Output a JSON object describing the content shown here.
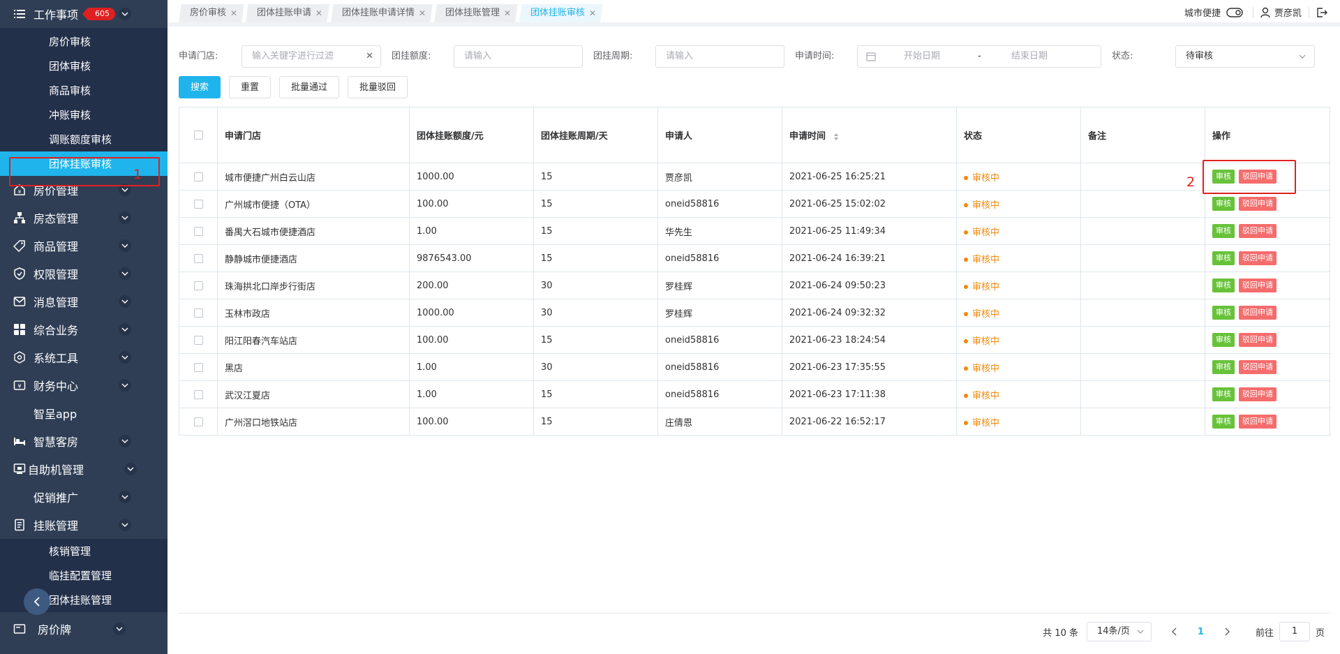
{
  "sidebar": {
    "top_item": {
      "label": "工作事项",
      "badge": "605",
      "icon": "list-icon"
    },
    "top_subitems": [
      "房价审核",
      "团体审核",
      "商品审核",
      "冲账审核",
      "调账额度审核",
      "团体挂账审核"
    ],
    "menu": [
      {
        "label": "房价管理",
        "icon": "home-price-icon"
      },
      {
        "label": "房态管理",
        "icon": "org-chart-icon"
      },
      {
        "label": "商品管理",
        "icon": "tag-icon"
      },
      {
        "label": "权限管理",
        "icon": "shield-icon"
      },
      {
        "label": "消息管理",
        "icon": "message-icon"
      },
      {
        "label": "综合业务",
        "icon": "grid-icon"
      },
      {
        "label": "系统工具",
        "icon": "hexagon-icon"
      },
      {
        "label": "财务中心",
        "icon": "finance-icon"
      },
      {
        "label": "智呈app",
        "icon": ""
      },
      {
        "label": "智慧客房",
        "icon": "bed-icon"
      },
      {
        "label": "自助机管理",
        "icon": "kiosk-icon"
      },
      {
        "label": "促销推广",
        "icon": ""
      },
      {
        "label": "挂账管理",
        "icon": "ledger-icon"
      }
    ],
    "bottom_subitems": [
      "核销管理",
      "临挂配置管理",
      "团体挂账管理"
    ],
    "last_item": {
      "label": "房价牌",
      "icon": "price-board-icon"
    }
  },
  "tabs": [
    {
      "label": "房价审核",
      "active": false
    },
    {
      "label": "团体挂账申请",
      "active": false
    },
    {
      "label": "团体挂账申请详情",
      "active": false
    },
    {
      "label": "团体挂账管理",
      "active": false
    },
    {
      "label": "团体挂账审核",
      "active": true
    }
  ],
  "topbar": {
    "hotel": "城市便捷",
    "user": "贾彦凯"
  },
  "filters": {
    "store_label": "申请门店:",
    "store_placeholder": "输入关键字进行过滤",
    "amount_label": "团挂额度:",
    "amount_placeholder": "请输入",
    "period_label": "团挂周期:",
    "period_placeholder": "请输入",
    "time_label": "申请时间:",
    "start_placeholder": "开始日期",
    "date_sep": "-",
    "end_placeholder": "结束日期",
    "status_label": "状态:",
    "status_value": "待审核"
  },
  "buttons": {
    "search": "搜索",
    "reset": "重置",
    "batch_pass": "批量通过",
    "batch_reject": "批量驳回"
  },
  "table": {
    "headers": [
      "申请门店",
      "团体挂账额度/元",
      "团体挂账周期/天",
      "申请人",
      "申请时间",
      "状态",
      "备注",
      "操作"
    ],
    "rows": [
      {
        "store": "城市便捷广州白云山店",
        "amount": "1000.00",
        "period": "15",
        "applicant": "贾彦凯",
        "time": "2021-06-25 16:25:21",
        "status": "审核中",
        "note": ""
      },
      {
        "store": "广州城市便捷（OTA）",
        "amount": "100.00",
        "period": "15",
        "applicant": "oneid58816",
        "time": "2021-06-25 15:02:02",
        "status": "审核中",
        "note": ""
      },
      {
        "store": "番禺大石城市便捷酒店",
        "amount": "1.00",
        "period": "15",
        "applicant": "华先生",
        "time": "2021-06-25 11:49:34",
        "status": "审核中",
        "note": ""
      },
      {
        "store": "静静城市便捷酒店",
        "amount": "9876543.00",
        "period": "15",
        "applicant": "oneid58816",
        "time": "2021-06-24 16:39:21",
        "status": "审核中",
        "note": ""
      },
      {
        "store": "珠海拱北口岸步行街店",
        "amount": "200.00",
        "period": "30",
        "applicant": "罗桂辉",
        "time": "2021-06-24 09:50:23",
        "status": "审核中",
        "note": ""
      },
      {
        "store": "玉林市政店",
        "amount": "1000.00",
        "period": "30",
        "applicant": "罗桂辉",
        "time": "2021-06-24 09:32:32",
        "status": "审核中",
        "note": ""
      },
      {
        "store": "阳江阳春汽车站店",
        "amount": "100.00",
        "period": "15",
        "applicant": "oneid58816",
        "time": "2021-06-23 18:24:54",
        "status": "审核中",
        "note": ""
      },
      {
        "store": "黑店",
        "amount": "1.00",
        "period": "30",
        "applicant": "oneid58816",
        "time": "2021-06-23 17:35:55",
        "status": "审核中",
        "note": ""
      },
      {
        "store": "武汉江夏店",
        "amount": "1.00",
        "period": "15",
        "applicant": "oneid58816",
        "time": "2021-06-23 17:11:38",
        "status": "审核中",
        "note": ""
      },
      {
        "store": "广州滘口地铁站店",
        "amount": "100.00",
        "period": "15",
        "applicant": "庄倩恩",
        "time": "2021-06-22 16:52:17",
        "status": "审核中",
        "note": ""
      }
    ],
    "op_approve": "审核",
    "op_reject": "驳回申请"
  },
  "annotations": {
    "one": "1",
    "two": "2"
  },
  "pager": {
    "total": "共 10 条",
    "page_size": "14条/页",
    "current": "1",
    "goto_label": "前往",
    "goto_value": "1",
    "page_unit": "页"
  },
  "colors": {
    "accent": "#1fb4ec",
    "sidebar": "#2f3e55",
    "pending": "#f0890a",
    "approve": "#67c23a",
    "reject": "#f56c6c",
    "annotation": "#e02020"
  }
}
